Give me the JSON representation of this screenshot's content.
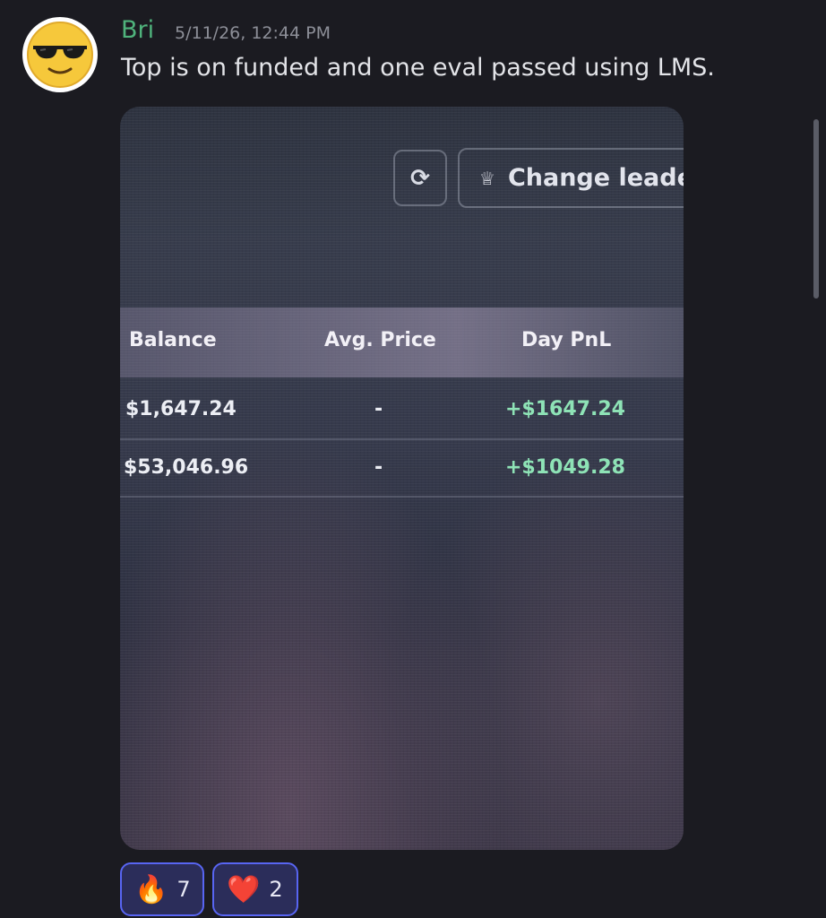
{
  "message": {
    "author": "Bri",
    "timestamp": "5/11/26, 12:44 PM",
    "text": "Top is on funded and one eval passed using LMS."
  },
  "photo": {
    "refresh_icon": "refresh-icon",
    "leader_button": "Change leade",
    "table": {
      "columns": [
        "Balance",
        "Avg. Price",
        "Day PnL"
      ],
      "rows": [
        {
          "balance": "$1,647.24",
          "avg_price": "-",
          "day_pnl": "+$1647.24"
        },
        {
          "balance": "$53,046.96",
          "avg_price": "-",
          "day_pnl": "+$1049.28"
        }
      ]
    }
  },
  "reactions": [
    {
      "emoji": "🔥",
      "icon": "fire-emoji-icon",
      "count": "7"
    },
    {
      "emoji": "❤️",
      "icon": "heart-emoji-icon",
      "count": "2"
    }
  ],
  "colors": {
    "author": "#4fb37c",
    "background": "#1b1b21",
    "reaction_border": "#5865f2",
    "pnl_positive": "#8ee3b6"
  }
}
